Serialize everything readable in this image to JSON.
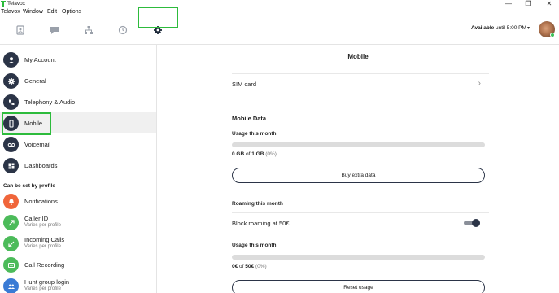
{
  "window": {
    "title": "Telavox",
    "minimize": "—",
    "restore": "❐",
    "close": "✕"
  },
  "menu": [
    "Telavox",
    "Window",
    "Edit",
    "Options"
  ],
  "toolbar": {
    "tabs": [
      "contacts-icon",
      "chat-icon",
      "org-chart-icon",
      "history-icon",
      "gear-icon"
    ],
    "active_tab": "gear-icon",
    "status": "Available",
    "status_until": "until 5:00 PM",
    "status_caret": "▾"
  },
  "sidebar": {
    "items": [
      {
        "label": "My Account",
        "icon": "user-icon"
      },
      {
        "label": "General",
        "icon": "gear-icon"
      },
      {
        "label": "Telephony & Audio",
        "icon": "phone-icon"
      },
      {
        "label": "Mobile",
        "icon": "mobile-icon",
        "active": true
      },
      {
        "label": "Voicemail",
        "icon": "voicemail-icon"
      },
      {
        "label": "Dashboards",
        "icon": "dashboard-icon"
      }
    ],
    "profile_section": "Can be set by profile",
    "profile_items": [
      {
        "label": "Notifications",
        "sub": "",
        "icon": "bell-icon",
        "color": "#f0653a"
      },
      {
        "label": "Caller ID",
        "sub": "Varies per profile",
        "icon": "arrow-out-icon",
        "color": "#4cbb5a"
      },
      {
        "label": "Incoming Calls",
        "sub": "Varies per profile",
        "icon": "arrow-in-icon",
        "color": "#4cbb5a"
      },
      {
        "label": "Call Recording",
        "sub": "",
        "icon": "recording-icon",
        "color": "#4cbb5a"
      },
      {
        "label": "Hunt group login",
        "sub": "Varies per profile",
        "icon": "group-icon",
        "color": "#3a7bd5"
      }
    ]
  },
  "main": {
    "title": "Mobile",
    "sim_card": "SIM card",
    "sim_chevron": "›",
    "mobile_data": "Mobile Data",
    "usage_this_month": "Usage this month",
    "data_used": "0 GB",
    "data_of": "of",
    "data_total": "1 GB",
    "data_pct": "(0%)",
    "data_fraction": 0,
    "buy_extra": "Buy extra data",
    "roaming_this_month": "Roaming this month",
    "block_roaming": "Block roaming at 50€",
    "block_roaming_on": true,
    "roam_usage_title": "Usage this month",
    "roam_used": "0€",
    "roam_of": "of",
    "roam_total": "50€",
    "roam_pct": "(0%)",
    "roam_fraction": 0,
    "reset_usage": "Reset usage"
  },
  "colors": {
    "accent_highlight": "#2dbb3c",
    "nav_icon_bg": "#2b3447",
    "bar_bg": "#dcdcdc"
  }
}
